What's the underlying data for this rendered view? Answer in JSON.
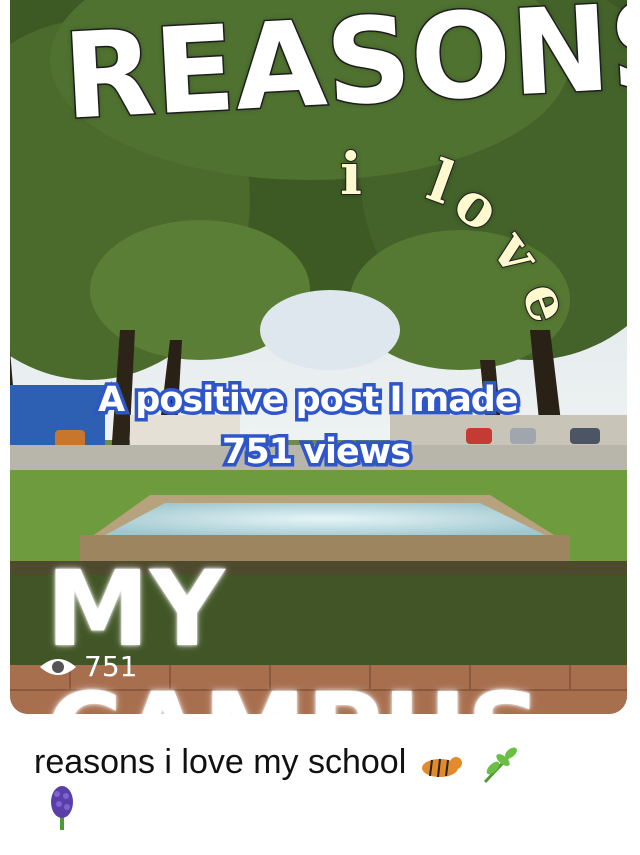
{
  "post": {
    "title_line1": "REASONS",
    "title_line2_i": "i",
    "title_line2_love": "love",
    "title_line3": "MY CAMPUS",
    "overlay_line1": "A positive post I made",
    "overlay_line2": "751 views",
    "view_count": "751",
    "caption": "reasons i love my school",
    "caption_emojis": [
      "tiger",
      "herb",
      "hyacinth"
    ],
    "icon_eye": "eye-icon"
  },
  "colors": {
    "overlay_outline": "#2f56c9",
    "sky": "#dfe7ee",
    "grass": "#6e9b3e"
  }
}
